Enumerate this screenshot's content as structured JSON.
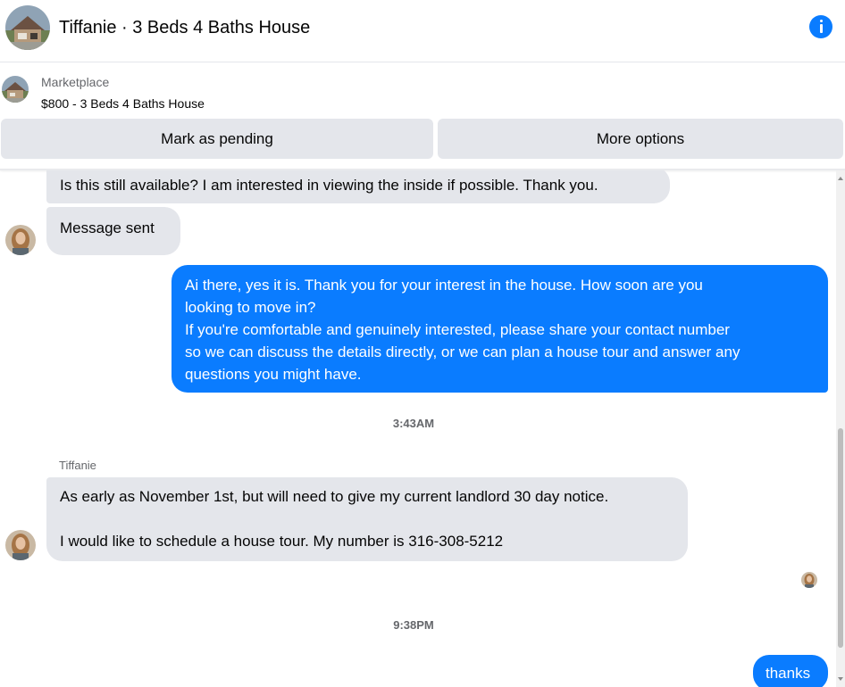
{
  "header": {
    "title": "Tiffanie · 3 Beds 4 Baths House",
    "info_icon": "info-icon",
    "accent_color": "#0a7cff"
  },
  "marketplace": {
    "label": "Marketplace",
    "item": "$800 - 3 Beds 4 Baths House"
  },
  "actions": {
    "mark_pending": "Mark as pending",
    "more_options": "More options"
  },
  "messages": [
    {
      "from": "Tiffanie",
      "text": "Is this still available? I am interested in viewing the inside if possible. Thank you."
    },
    {
      "from": "Tiffanie",
      "text": "Message sent"
    },
    {
      "from": "me",
      "lines": [
        "Ai there, yes it is. Thank you for your interest in the house. How soon are you",
        "looking to move in?",
        "If you're comfortable and genuinely interested, please share your contact number",
        "so we can discuss the details directly, or we can plan a house tour and answer any",
        "questions you might have."
      ]
    },
    {
      "timestamp": "3:43AM"
    },
    {
      "sender_label": "Tiffanie",
      "from": "Tiffanie",
      "lines": [
        "As early as November 1st, but will need to give my current landlord 30 day notice.",
        "",
        "I would like to schedule a house tour. My number is 316-308-5212"
      ]
    },
    {
      "timestamp": "9:38PM"
    },
    {
      "from": "me",
      "text": "thanks"
    }
  ]
}
